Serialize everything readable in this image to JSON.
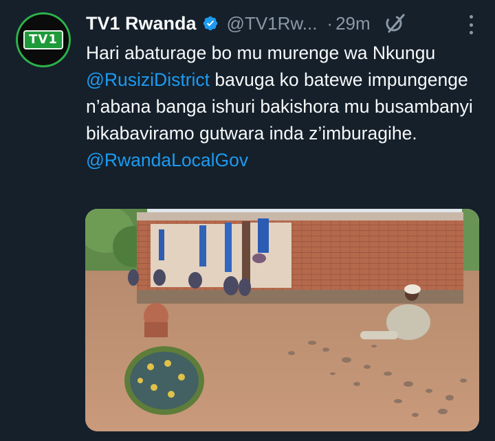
{
  "account": {
    "avatar_text": "TV1",
    "display_name": "TV1 Rwanda",
    "handle": "@TV1Rw...",
    "separator": "·",
    "time": "29m"
  },
  "tweet": {
    "text_part1": "Hari abaturage bo mu murenge wa Nkungu ",
    "mention1": "@RusiziDistrict",
    "text_part2": "  bavuga ko batewe impungenge n’abana banga ishuri bakishora mu busambanyi bikabaviramo gutwara inda z’imburagihe.",
    "mention2": "@RwandaLocalGov"
  },
  "icons": {
    "verified": "verified-badge-icon",
    "grok": "grok-icon",
    "more": "more-options-icon"
  },
  "colors": {
    "background": "#15202b",
    "text": "#f7f9f9",
    "secondary": "#8b98a5",
    "link": "#1d9bf0",
    "avatar_ring": "#2db24a"
  }
}
